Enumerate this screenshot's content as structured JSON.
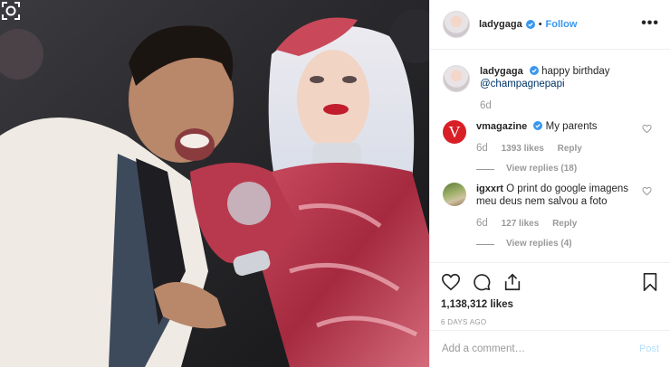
{
  "post": {
    "author": "ladygaga",
    "separator": "•",
    "follow_label": "Follow",
    "more_label": "•••"
  },
  "caption": {
    "author": "ladygaga",
    "text": "happy birthday",
    "mention": "@champagnepapi",
    "time": "6d"
  },
  "comments": [
    {
      "author": "vmagazine",
      "avatar_letter": "V",
      "text": "My parents",
      "time": "6d",
      "likes": "1393 likes",
      "reply_label": "Reply",
      "view_replies": "View replies (18)",
      "verified": true
    },
    {
      "author": "igxxrt",
      "text": "O print do google imagens meu deus nem salvou a foto",
      "time": "6d",
      "likes": "127 likes",
      "reply_label": "Reply",
      "view_replies": "View replies (4)",
      "verified": false
    }
  ],
  "stats": {
    "likes": "1,138,312 likes",
    "date": "6 DAYS AGO"
  },
  "add_comment": {
    "placeholder": "Add a comment…",
    "post_label": "Post"
  },
  "colors": {
    "link": "#3897f0",
    "verified": "#3897f0",
    "vmag": "#d81f26"
  }
}
